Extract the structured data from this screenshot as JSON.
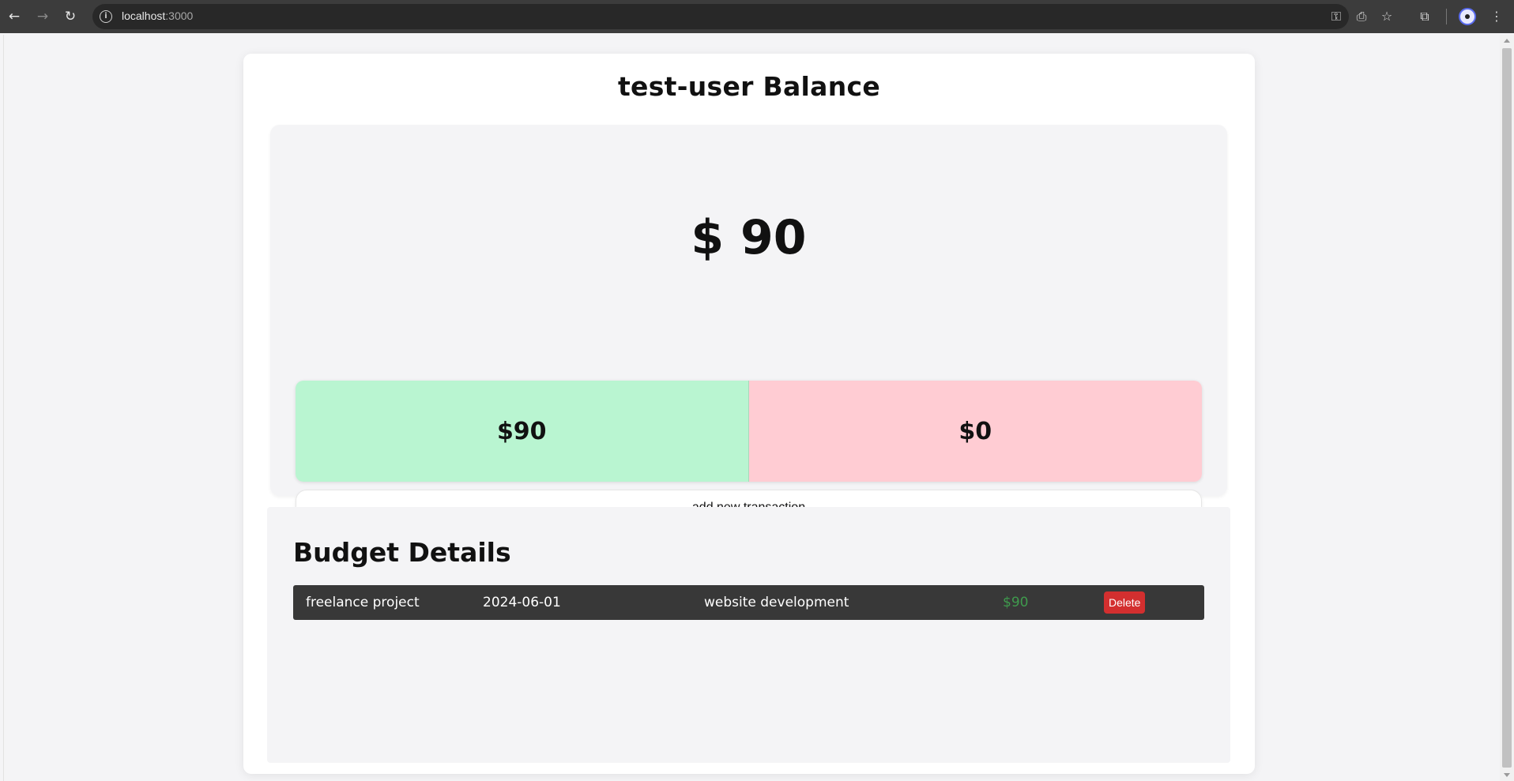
{
  "browser": {
    "url_host": "localhost",
    "url_port": ":3000"
  },
  "page": {
    "title": "test-user Balance",
    "balance": "$ 90",
    "income": "$90",
    "expense": "$0",
    "add_button": "add new transaction"
  },
  "budget": {
    "title": "Budget Details",
    "rows": [
      {
        "name": "freelance project",
        "date": "2024-06-01",
        "description": "website development",
        "amount": "$90",
        "delete_label": "Delete"
      }
    ]
  },
  "colors": {
    "income_bg": "#b9f5d1",
    "expense_bg": "#ffccd3",
    "row_bg": "#383838",
    "amount_text": "#3f9a4d",
    "delete_bg": "#d32f2f"
  }
}
